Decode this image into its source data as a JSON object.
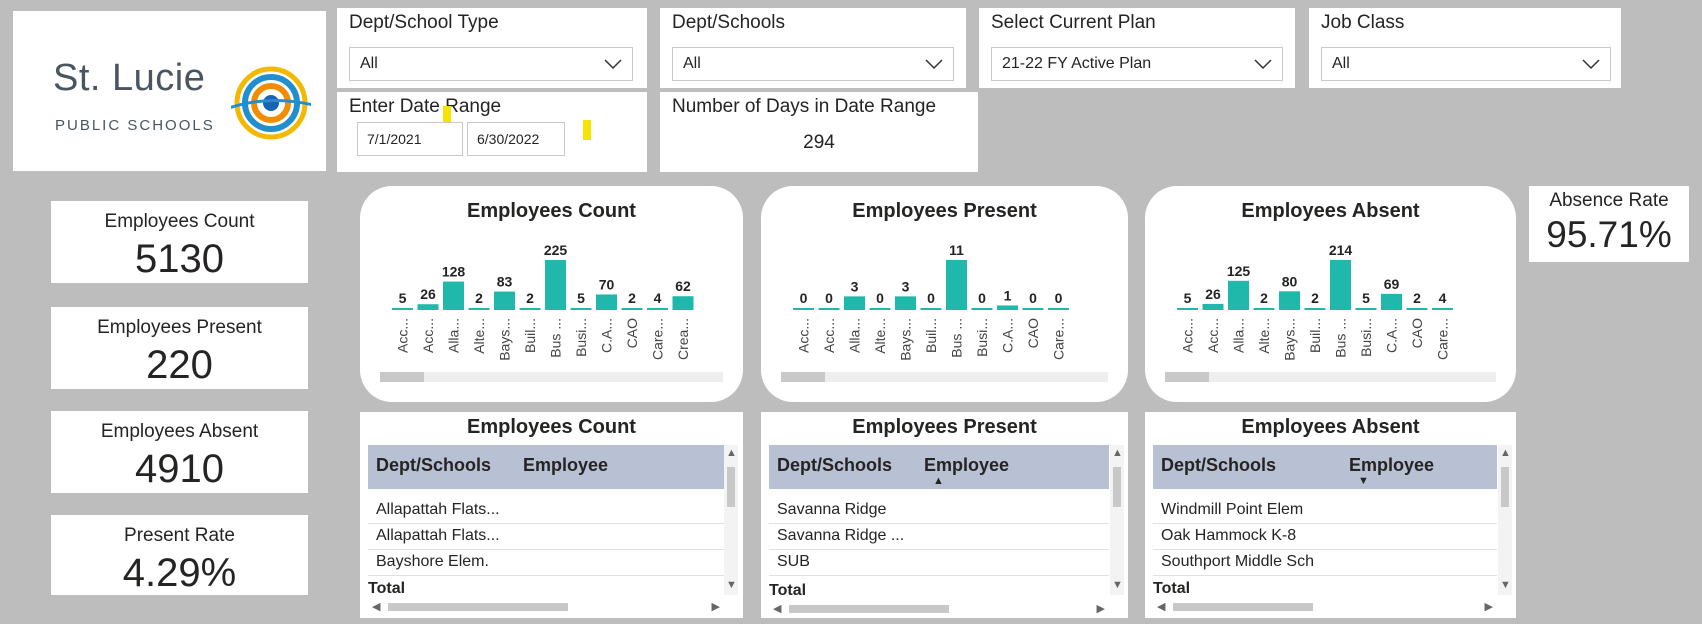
{
  "logo": {
    "name": "St. Lucie",
    "sub": "PUBLIC SCHOOLS"
  },
  "filters": {
    "dept_type": {
      "title": "Dept/School Type",
      "value": "All"
    },
    "dept_schools": {
      "title": "Dept/Schools",
      "value": "All"
    },
    "plan": {
      "title": "Select Current Plan",
      "value": "21-22 FY Active Plan"
    },
    "job_class": {
      "title": "Job Class",
      "value": "All"
    },
    "date_range": {
      "title": "Enter Date Range",
      "start": "7/1/2021",
      "end": "6/30/2022"
    },
    "days": {
      "title": "Number of Days in Date Range",
      "value": "294"
    }
  },
  "kpis": {
    "count": {
      "label": "Employees Count",
      "value": "5130"
    },
    "present": {
      "label": "Employees Present",
      "value": "220"
    },
    "absent": {
      "label": "Employees Absent",
      "value": "4910"
    },
    "present_rate": {
      "label": "Present Rate",
      "value": "4.29%"
    },
    "absence_rate": {
      "label": "Absence Rate",
      "value": "95.71%"
    }
  },
  "colors": {
    "bar": "#1fb8aa",
    "header": "#b8c0d4"
  },
  "chart_data": [
    {
      "type": "bar",
      "title": "Employees Count",
      "categories": [
        "Acc...",
        "Acc...",
        "Alla...",
        "Alte...",
        "Bays...",
        "Buil...",
        "Bus ...",
        "Busi...",
        "C.A...",
        "CAO",
        "Care...",
        "Crea..."
      ],
      "values": [
        5,
        26,
        128,
        2,
        83,
        2,
        225,
        5,
        70,
        2,
        4,
        62
      ],
      "ylim": [
        0,
        225
      ]
    },
    {
      "type": "bar",
      "title": "Employees Present",
      "categories": [
        "Acc...",
        "Acc...",
        "Alla...",
        "Alte...",
        "Bays...",
        "Buil...",
        "Bus ...",
        "Busi...",
        "C.A...",
        "CAO",
        "Care..."
      ],
      "values": [
        0,
        0,
        3,
        0,
        3,
        0,
        11,
        0,
        1,
        0,
        0
      ],
      "ylim": [
        0,
        11
      ]
    },
    {
      "type": "bar",
      "title": "Employees Absent",
      "categories": [
        "Acc...",
        "Acc...",
        "Alla...",
        "Alte...",
        "Bays...",
        "Buil...",
        "Bus ...",
        "Busi...",
        "C.A...",
        "CAO",
        "Care..."
      ],
      "values": [
        5,
        26,
        125,
        2,
        80,
        2,
        214,
        5,
        69,
        2,
        4
      ],
      "ylim": [
        0,
        214
      ]
    }
  ],
  "tables": {
    "count": {
      "title": "Employees Count",
      "col1": "Dept/Schools",
      "col2": "Employee",
      "rows": [
        "Allapattah Flats...",
        "Allapattah Flats...",
        "Bayshore Elem."
      ],
      "total": "Total"
    },
    "present": {
      "title": "Employees Present",
      "col1": "Dept/Schools",
      "col2": "Employee",
      "rows": [
        "Savanna Ridge",
        "Savanna Ridge ...",
        "SUB"
      ],
      "total": "Total"
    },
    "absent": {
      "title": "Employees Absent",
      "col1": "Dept/Schools",
      "col2": "Employee",
      "rows": [
        "Windmill Point Elem",
        "Oak Hammock K-8",
        "Southport Middle Sch"
      ],
      "total": "Total"
    }
  }
}
